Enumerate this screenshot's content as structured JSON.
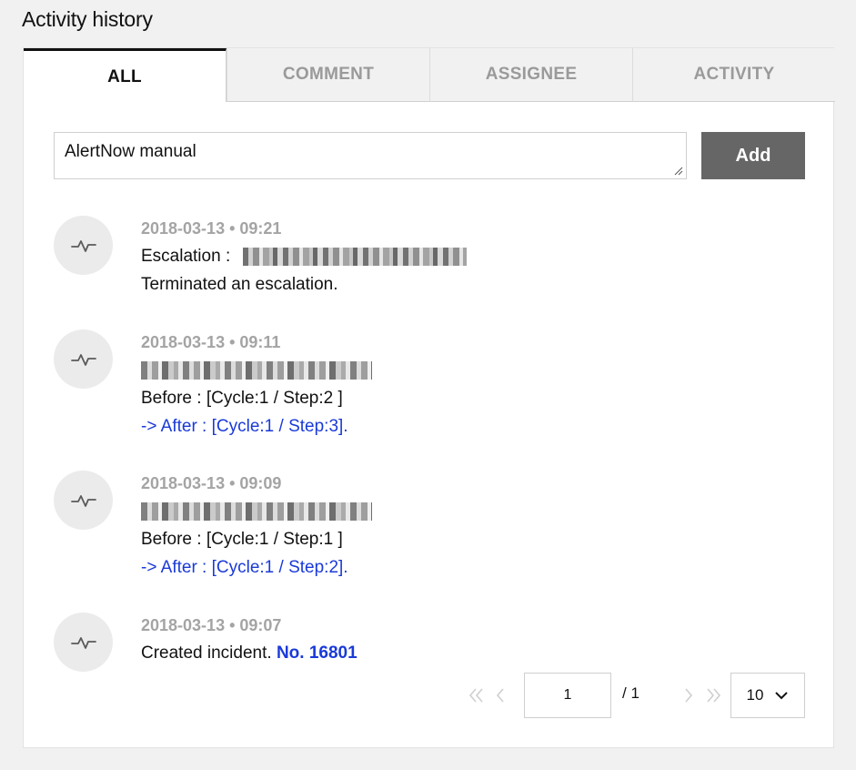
{
  "section": {
    "title": "Activity history"
  },
  "tabs": [
    {
      "label": "ALL",
      "active": true
    },
    {
      "label": "COMMENT",
      "active": false
    },
    {
      "label": "ASSIGNEE",
      "active": false
    },
    {
      "label": "ACTIVITY",
      "active": false
    }
  ],
  "comment": {
    "value": "AlertNow manual",
    "add_label": "Add"
  },
  "activities": [
    {
      "icon": "activity-pulse-icon",
      "time": "2018-03-13 • 09:21",
      "label": "Escalation :",
      "text": "Terminated an escalation."
    },
    {
      "icon": "activity-pulse-icon",
      "time": "2018-03-13 • 09:11",
      "before": "Before : [Cycle:1 / Step:2 ]",
      "after": "-> After : [Cycle:1 / Step:3]."
    },
    {
      "icon": "activity-pulse-icon",
      "time": "2018-03-13 • 09:09",
      "before": "Before : [Cycle:1 / Step:1 ]",
      "after": "-> After : [Cycle:1 / Step:2]."
    },
    {
      "icon": "activity-pulse-icon",
      "time": "2018-03-13 • 09:07",
      "text": "Created incident.",
      "link": "No. 16801"
    }
  ],
  "pagination": {
    "current_page": "1",
    "total": "/ 1",
    "page_size": "10"
  },
  "colors": {
    "link": "#1a3ad8",
    "add_button": "#666666",
    "timestamp": "#a4a4a4"
  }
}
